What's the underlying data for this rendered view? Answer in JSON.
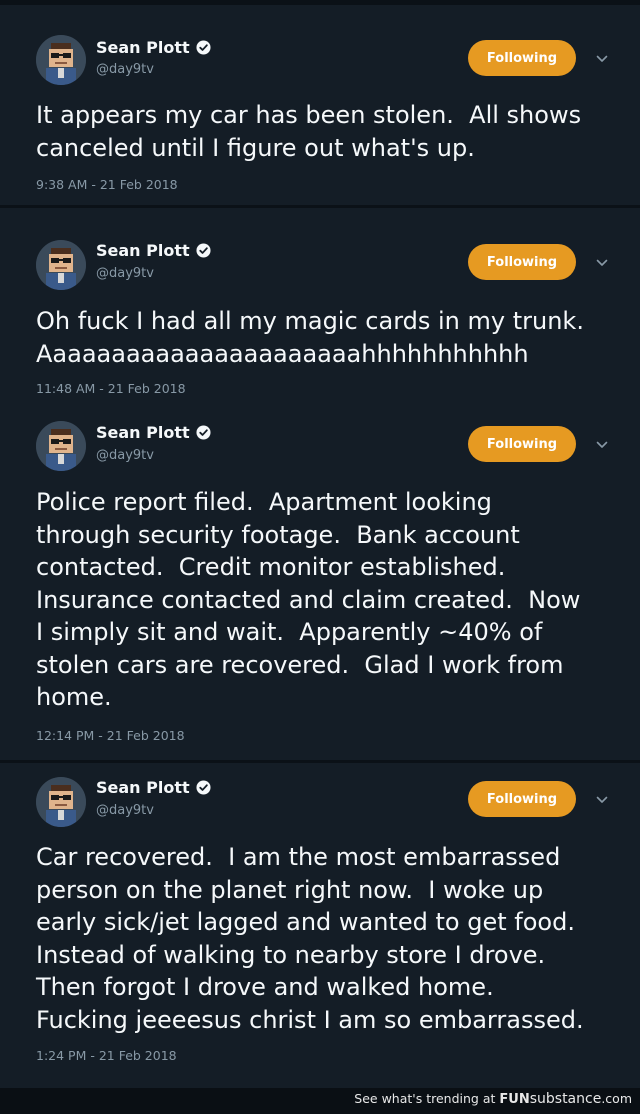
{
  "colors": {
    "background": "#141d26",
    "text": "#f5f8fa",
    "muted": "#8899a6",
    "follow_button": "#e69a22",
    "separator": "#0b1117"
  },
  "tweets": [
    {
      "name": "Sean Plott",
      "handle": "@day9tv",
      "follow_label": "Following",
      "text": "It appears my car has been stolen.  All shows\ncanceled until I figure out what's up.",
      "timestamp": "9:38 AM - 21 Feb 2018"
    },
    {
      "name": "Sean Plott",
      "handle": "@day9tv",
      "follow_label": "Following",
      "text": "Oh fuck I had all my magic cards in my trunk.\nAaaaaaaaaaaaaaaaaaaaaahhhhhhhhhhh",
      "timestamp": "11:48 AM - 21 Feb 2018"
    },
    {
      "name": "Sean Plott",
      "handle": "@day9tv",
      "follow_label": "Following",
      "text": "Police report filed.  Apartment looking\nthrough security footage.  Bank account\ncontacted.  Credit monitor established.\nInsurance contacted and claim created.  Now\nI simply sit and wait.  Apparently ~40% of\nstolen cars are recovered.  Glad I work from\nhome.",
      "timestamp": "12:14 PM - 21 Feb 2018"
    },
    {
      "name": "Sean Plott",
      "handle": "@day9tv",
      "follow_label": "Following",
      "text": "Car recovered.  I am the most embarrassed\nperson on the planet right now.  I woke up\nearly sick/jet lagged and wanted to get food.\nInstead of walking to nearby store I drove.\nThen forgot I drove and walked home.\nFucking jeeeesus christ I am so embarrassed.",
      "timestamp": "1:24 PM - 21 Feb 2018"
    }
  ],
  "footer": {
    "prefix": "See what's trending at",
    "brand_bold": "FUN",
    "brand_rest": "substance",
    "suffix": ".com"
  }
}
